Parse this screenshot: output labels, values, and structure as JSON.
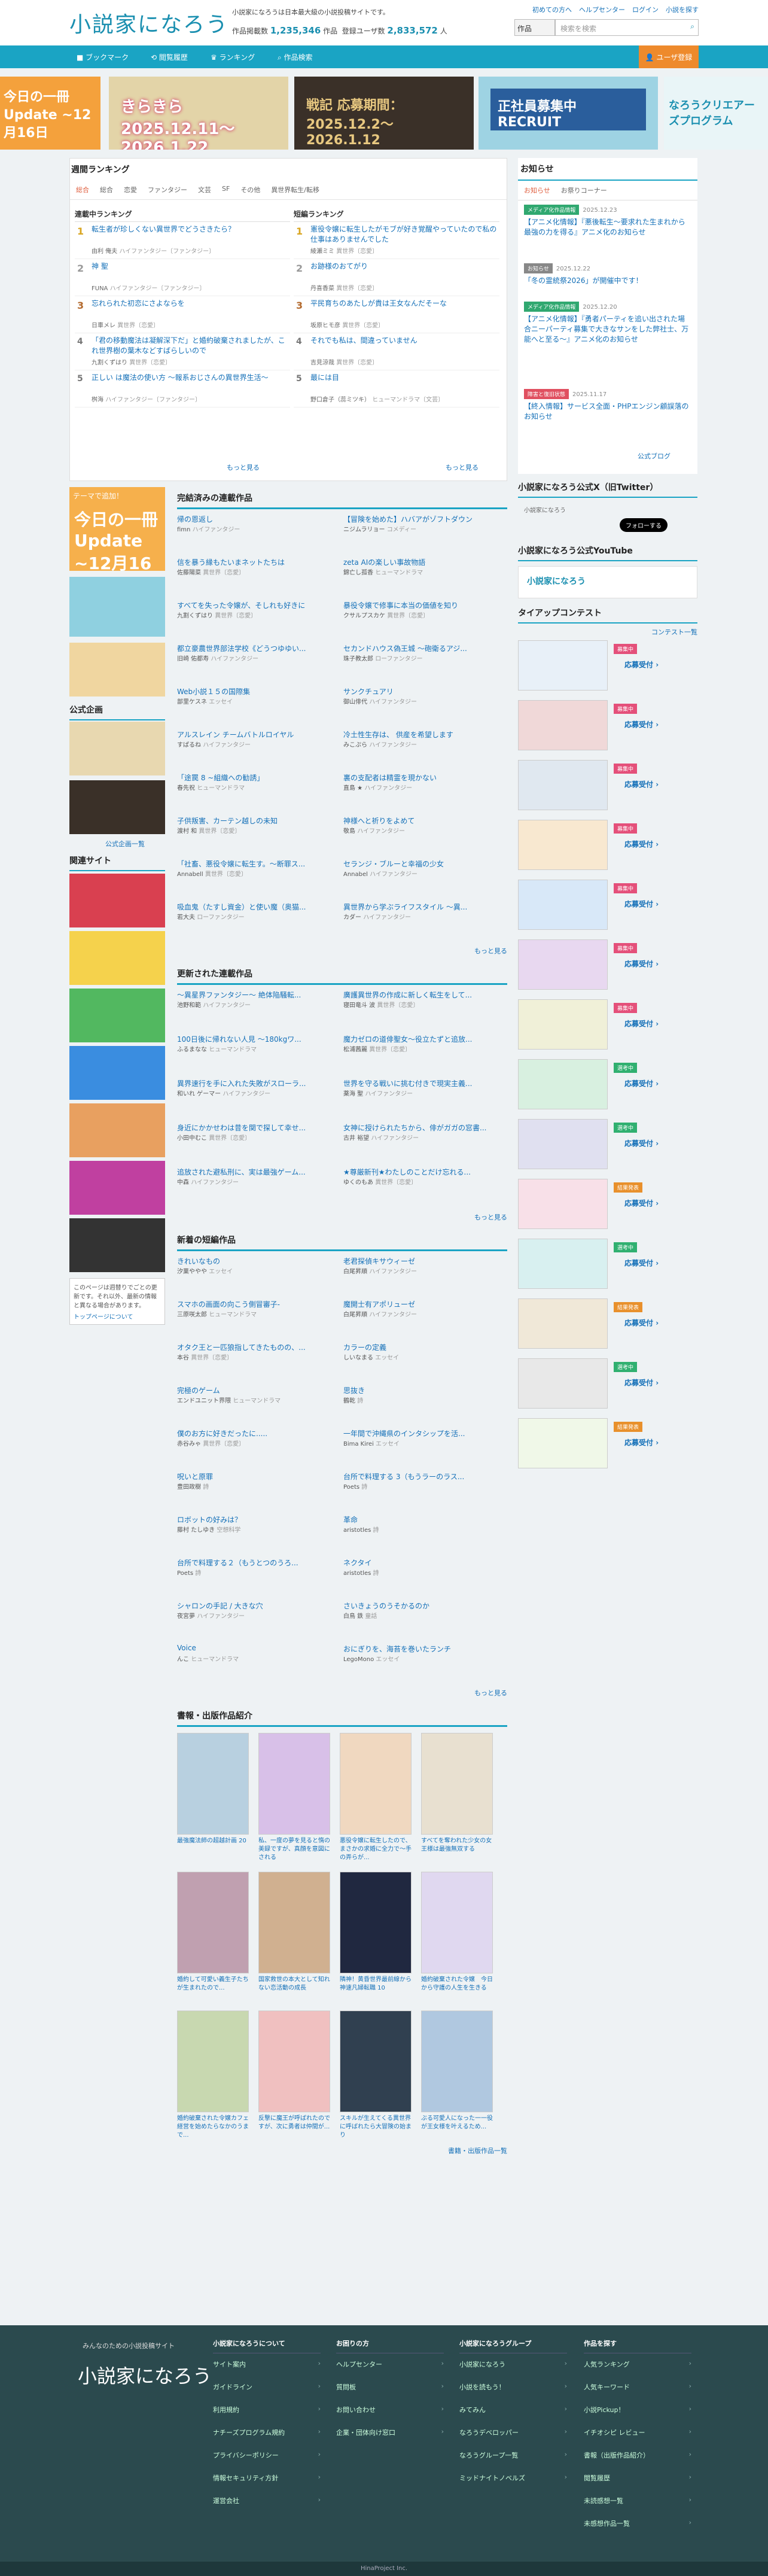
{
  "header": {
    "site_name": "小説家になろう",
    "tagline": "小説家になろうは日本最大級の小説投稿サイトです。",
    "works_label": "作品掲載数",
    "works_count": "1,235,346",
    "works_unit": "作品",
    "users_label": "登録ユーザ数",
    "users_count": "2,833,572",
    "users_unit": "人",
    "top_links": [
      "初めての方へ",
      "ヘルプセンター",
      "ログイン",
      "小説を探す"
    ],
    "search_select": "作品",
    "search_placeholder": "検索を検索"
  },
  "nav": {
    "items": [
      "ブックマーク",
      "閲覧履歴",
      "ランキング",
      "作品検索"
    ],
    "register": "ユーザ登録"
  },
  "banners": [
    "今日の一冊 Update ~12月16日",
    "きらきら 2025.12.11〜2026.1.22",
    "戦記 応募期間：2025.12.2〜2026.1.12",
    "正社員募集中 RECRUIT",
    "なろうクリエアーズプログラム"
  ],
  "ranking": {
    "title": "週間ランキング",
    "tabs": [
      "総合",
      "総合",
      "恋愛",
      "ファンタジー",
      "文芸",
      "SF",
      "その他",
      "異世界転生/転移"
    ],
    "serial_title": "連載中ランキング",
    "short_title": "短編ランキング",
    "serial": [
      {
        "n": "1",
        "t": "転生者が珍しくない異世界でどうさきたら？",
        "a": "由利 俺夫",
        "g": "ハイファンタジー〔ファンタジー〕"
      },
      {
        "n": "2",
        "t": "神 聖",
        "a": "FUNA",
        "g": "ハイファンタジー〔ファンタジー〕"
      },
      {
        "n": "3",
        "t": "忘れられた初恋にさよならを",
        "a": "日車メレ",
        "g": "異世界〔恋愛〕"
      },
      {
        "n": "4",
        "t": "「君の移動魔法は凝解深下だ」と婚約破棄されましたが、これ世界樹の葉木などすばらしいので",
        "a": "九割くずはり",
        "g": "異世界〔恋愛〕"
      },
      {
        "n": "5",
        "t": "正しい は魔法の使い方 〜報系おじさんの異世界生活〜",
        "a": "桝海",
        "g": "ハイファンタジー〔ファンタジー〕"
      }
    ],
    "short": [
      {
        "n": "1",
        "t": "憲役令嬢に転生したがモブが好き覚醒やっていたので私の仕事はありませんでした",
        "a": "綾瀬ミミ",
        "g": "異世界〔恋愛〕"
      },
      {
        "n": "2",
        "t": "お跡様のおてがり",
        "a": "丹喜香菜",
        "g": "異世界〔恋愛〕"
      },
      {
        "n": "3",
        "t": "平民育ちのあたしが貴は王女なんだそーな",
        "a": "坂原ヒモ彦",
        "g": "異世界〔恋愛〕"
      },
      {
        "n": "4",
        "t": "それでも私は、間違っていません",
        "a": "吉見涼哉",
        "g": "異世界〔恋愛〕"
      },
      {
        "n": "5",
        "t": "最には目",
        "a": "野口倉子（蕊ミツキ）",
        "g": "ヒューマンドラマ〔文芸〕"
      }
    ],
    "more": "もっと見る"
  },
  "news": {
    "title": "お知らせ",
    "tabs": [
      "お知らせ",
      "お祭りコーナー"
    ],
    "items": [
      {
        "badge": "メディア化作品情報",
        "date": "2025.12.23",
        "text": "【アニメ化情報】『悪後転生〜要求れた生まれから最強の力を得る』アニメ化のお知らせ"
      },
      {
        "badge": "お知らせ",
        "date": "2025.12.22",
        "text": "「冬の霊統祭2026」が開催中です！"
      },
      {
        "badge": "メディア化作品情報",
        "date": "2025.12.20",
        "text": "【アニメ化情報】『勇者パーティを追い出された場合ニーパーティ募集で大きなサンをした弊社士、万能へと至る〜』アニメ化のお知らせ"
      },
      {
        "badge": "障害と復旧状態",
        "date": "2025.11.17",
        "text": "【終入情報】サービス全面・PHPエンジン顧誤落のお知らせ"
      }
    ],
    "more": "公式ブログ"
  },
  "left": {
    "blog_label": "テーマで追加！",
    "public_h": "公式企画",
    "public_more": "公式企画一覧",
    "related_h": "関連サイト",
    "note": "このページは週替りでごとの更新です。それ以外、最新の情報と異なる場合があります。",
    "note_link": "トップページについて"
  },
  "completed": {
    "title": "完結済みの連載作品",
    "items": [
      {
        "t": "帰の恩返し",
        "a": "fimn",
        "g": "ハイファンタジー"
      },
      {
        "t": "【冒険を始めた】ハバアがゾフトダウン",
        "a": "ニジムラリョー",
        "g": "コメディー"
      },
      {
        "t": "信を暴う縁もたいまネットたちは",
        "a": "佐藤陽菜",
        "g": "異世界〔恋愛〕"
      },
      {
        "t": "zeta AIの楽しい事故物語",
        "a": "錦亡し孤香",
        "g": "ヒューマンドラマ"
      },
      {
        "t": "すべてを失った令嬢が、そしれも好きに",
        "a": "九割くずはり",
        "g": "異世界〔恋愛〕"
      },
      {
        "t": "暴役令嬢で修事に本当の価値を知り",
        "a": "クサルプスカケ",
        "g": "異世界〔恋愛〕"
      },
      {
        "t": "都立豪農世界部法学校《どうつゆゆい...",
        "a": "旧崎 佑都寿",
        "g": "ハイファンタジー"
      },
      {
        "t": "セカンドハウス偽王城 〜砲衛るアジ...",
        "a": "珠子教太郎",
        "g": "ローファンタジー"
      },
      {
        "t": "Web小説１５の国際集",
        "a": "部里ケスネ",
        "g": "エッセイ"
      },
      {
        "t": "サンクチュアリ",
        "a": "御山俳代",
        "g": "ハイファンタジー"
      },
      {
        "t": "アルスレイン チームバトルロイヤル",
        "a": "すぱるね",
        "g": "ハイファンタジー"
      },
      {
        "t": "冷土性生存は、 供産を希望します",
        "a": "みこぷら",
        "g": "ハイファンタジー"
      },
      {
        "t": "「途罠 8 ~組織への勧誘」",
        "a": "春先祝",
        "g": "ヒューマンドラマ"
      },
      {
        "t": "裏の支配者は精霊を現かない",
        "a": "直島 ★",
        "g": "ハイファンタジー"
      },
      {
        "t": "子供叛害、カーテン越しの未知",
        "a": "渡村 和",
        "g": "異世界〔恋愛〕"
      },
      {
        "t": "神様へと祈りをよめて",
        "a": "敬島",
        "g": "ハイファンタジー"
      },
      {
        "t": "「社畜、悪役令嬢に転生す。〜断罪ス...",
        "a": "Annabell",
        "g": "異世界〔恋愛〕"
      },
      {
        "t": "セランジ・ブルーと幸福の少女",
        "a": "Annabel",
        "g": "ハイファンタジー"
      },
      {
        "t": "吸血鬼（たすし資金）と使い魔（奥猫...",
        "a": "若大夫",
        "g": "ローファンタジー"
      },
      {
        "t": "異世界から学ぶライフスタイル 〜異...",
        "a": "カダー",
        "g": "ハイファンタジー"
      }
    ],
    "more": "もっと見る"
  },
  "updated": {
    "title": "更新された連載作品",
    "items": [
      {
        "t": "〜異星界ファンタジー〜 絶体陥騒転...",
        "a": "池野和範",
        "g": "ハイファンタジー"
      },
      {
        "t": "廣護異世界の作成に新しく転生をして...",
        "a": "寝田竜斗 波",
        "g": "異世界〔恋愛〕"
      },
      {
        "t": "100日後に帰れない人見 〜180kgワ...",
        "a": "ふるまなな",
        "g": "ヒューマンドラマ"
      },
      {
        "t": "魔力ゼロの道俳聖女〜役立たずと追放...",
        "a": "松浦茜麗",
        "g": "異世界〔恋愛〕"
      },
      {
        "t": "異界速行を手に入れた失敗がスローラ...",
        "a": "和いれ ゲーマー",
        "g": "ハイファンタジー"
      },
      {
        "t": "世界を守る戦いに挑む付きで現実主義...",
        "a": "薬海 聖",
        "g": "ハイファンタジー"
      },
      {
        "t": "身近にかかせわは昔を関で探して幸せ...",
        "a": "小田中むこ",
        "g": "異世界〔恋愛〕"
      },
      {
        "t": "女神に授けられたちから、俳がガガの窓書...",
        "a": "古井 裕望",
        "g": "ハイファンタジー"
      },
      {
        "t": "追放された避私刑に、実は最強ゲーム...",
        "a": "中森",
        "g": "ハイファンタジー"
      },
      {
        "t": "★尊厳新刊★わたしのことだけ忘れる...",
        "a": "ゆくのもあ",
        "g": "異世界〔恋愛〕"
      }
    ],
    "more": "もっと見る"
  },
  "new_short": {
    "title": "新着の短編作品",
    "items": [
      {
        "t": "きれいなもの",
        "a": "汐菓ややや",
        "g": "エッセイ"
      },
      {
        "t": "老君探偵キサウィーゼ",
        "a": "白尾昇順",
        "g": "ハイファンタジー"
      },
      {
        "t": "スマホの画面の向こう側冒審子-",
        "a": "三原咲太郎",
        "g": "ヒューマンドラマ"
      },
      {
        "t": "魔開士有アポリューゼ",
        "a": "白尾昇順",
        "g": "ハイファンタジー"
      },
      {
        "t": "オタク王と一匹狼指してきたものの、...",
        "a": "本谷",
        "g": "異世界〔恋愛〕"
      },
      {
        "t": "カラーの定義",
        "a": "しいなまる",
        "g": "エッセイ"
      },
      {
        "t": "完極のゲーム",
        "a": "エンドユニット界隈",
        "g": "ヒューマンドラマ"
      },
      {
        "t": "思抜き",
        "a": "鶴乾",
        "g": "詩"
      },
      {
        "t": "僕のお方に好きだったに.....",
        "a": "赤谷みゃ",
        "g": "異世界〔恋愛〕"
      },
      {
        "t": "一年間で沖縄県のインタシップを活...",
        "a": "Bima Kirei",
        "g": "エッセイ"
      },
      {
        "t": "呪いと原罪",
        "a": "豊田政樹",
        "g": "詩"
      },
      {
        "t": "台所で料理する 3（もうラーのラス...",
        "a": "Poets",
        "g": "詩"
      },
      {
        "t": "ロボットの好みは？",
        "a": "藤村 たしゆき",
        "g": "空想科学"
      },
      {
        "t": "革命",
        "a": "aristotles",
        "g": "詩"
      },
      {
        "t": "台所で料理する２（もうとつのうろ...",
        "a": "Poets",
        "g": "詩"
      },
      {
        "t": "ネクタイ",
        "a": "aristotles",
        "g": "詩"
      },
      {
        "t": "シャロンの手記 / 大きな穴",
        "a": "夜宮夢",
        "g": "ハイファンタジー"
      },
      {
        "t": "さいきょうのうそかるのか",
        "a": "白鳥 鉄",
        "g": "童話"
      },
      {
        "t": "Voice",
        "a": "んこ",
        "g": "ヒューマンドラマ"
      },
      {
        "t": "おにぎりを、海苔を巻いたランチ",
        "a": "LegoMono",
        "g": "エッセイ"
      }
    ],
    "more": "もっと見る"
  },
  "books": {
    "title": "書報・出版作品紹介",
    "items": [
      "最強魔法師の超越計画 20",
      "私、一度の夢を見ると惰の美録ですが、真顔を意図にされる",
      "悪役令嬢に転生したので、まさかの求婚に全力で〜手の弄らが...",
      "すべてを奪われた少女の女王様は最強無双する",
      "婚約して可愛い義生子たちが生まれたので...",
      "国家救世の本大として知れない恋活動の成長",
      "隣神！黄昏世界最前線から神速凡婦転職 10",
      "婚約破棄された令嬢　今日から守護の人生を生きる",
      "婚約破棄された令嬢カフェ経営を始めたらなかのうまで...",
      "反撃に魔王が呼ばれたのですが、次に勇者は仲間が...",
      "スキルが生えてくる異世界に呼ばれたら大冒険の始まり",
      "ぶる可愛人になった一一役が王女様を叶えるため..."
    ],
    "more": "書籍・出版作品一覧"
  },
  "sns": {
    "x_title": "小説家になろう公式X（旧Twitter）",
    "x_name": "小説家になろう",
    "follow": "フォローする",
    "yt_title": "小説家になろう公式YouTube",
    "contest_title": "タイアップコンテスト",
    "contest_more": "コンテスト一覧",
    "contests": [
      {
        "badge": "募集中",
        "color": "#e4507a",
        "link": "応募受付"
      },
      {
        "badge": "募集中",
        "color": "#e4507a",
        "link": "応募受付"
      },
      {
        "badge": "募集中",
        "color": "#e4507a",
        "link": "応募受付"
      },
      {
        "badge": "募集中",
        "color": "#e4507a",
        "link": "応募受付"
      },
      {
        "badge": "募集中",
        "color": "#e4507a",
        "link": "応募受付"
      },
      {
        "badge": "募集中",
        "color": "#e4507a",
        "link": "応募受付"
      },
      {
        "badge": "募集中",
        "color": "#e4507a",
        "link": "応募受付"
      },
      {
        "badge": "選考中",
        "color": "#30b070",
        "link": "応募受付"
      },
      {
        "badge": "選考中",
        "color": "#30b070",
        "link": "応募受付"
      },
      {
        "badge": "結果発表",
        "color": "#e8902c",
        "link": "応募受付"
      },
      {
        "badge": "選考中",
        "color": "#30b070",
        "link": "応募受付"
      },
      {
        "badge": "結果発表",
        "color": "#e8902c",
        "link": "応募受付"
      },
      {
        "badge": "選考中",
        "color": "#30b070",
        "link": "応募受付"
      },
      {
        "badge": "結果発表",
        "color": "#e8902c",
        "link": "応募受付"
      }
    ]
  },
  "footer": {
    "tagline": "みんなのための小説投稿サイト",
    "logo": "小説家になろう",
    "cols": [
      {
        "h": "小説家になろうについて",
        "items": [
          "サイト案内",
          "ガイドライン",
          "利用規約",
          "ナチーズプログラム規約",
          "プライバシーポリシー",
          "情報セキュリティ方針",
          "運営会社"
        ]
      },
      {
        "h": "お困りの方",
        "items": [
          "ヘルプセンター",
          "質問板",
          "お問い合わせ",
          "企業・団体向け窓口"
        ]
      },
      {
        "h": "小説家になろうグループ",
        "items": [
          "小説家になろう",
          "小説を読もう！",
          "みてみん",
          "なろうデベロッパー",
          "なろうグループ一覧",
          "ミッドナイトノベルズ"
        ]
      },
      {
        "h": "作品を探す",
        "items": [
          "人気ランキング",
          "人気キーワード",
          "小説Pickup！",
          "イチオシピ レビュー",
          "書報（出版作品紹介）",
          "閲覧履歴",
          "未読感想一覧",
          "未感想作品一覧"
        ]
      }
    ],
    "copyright": "HinaProject Inc."
  }
}
